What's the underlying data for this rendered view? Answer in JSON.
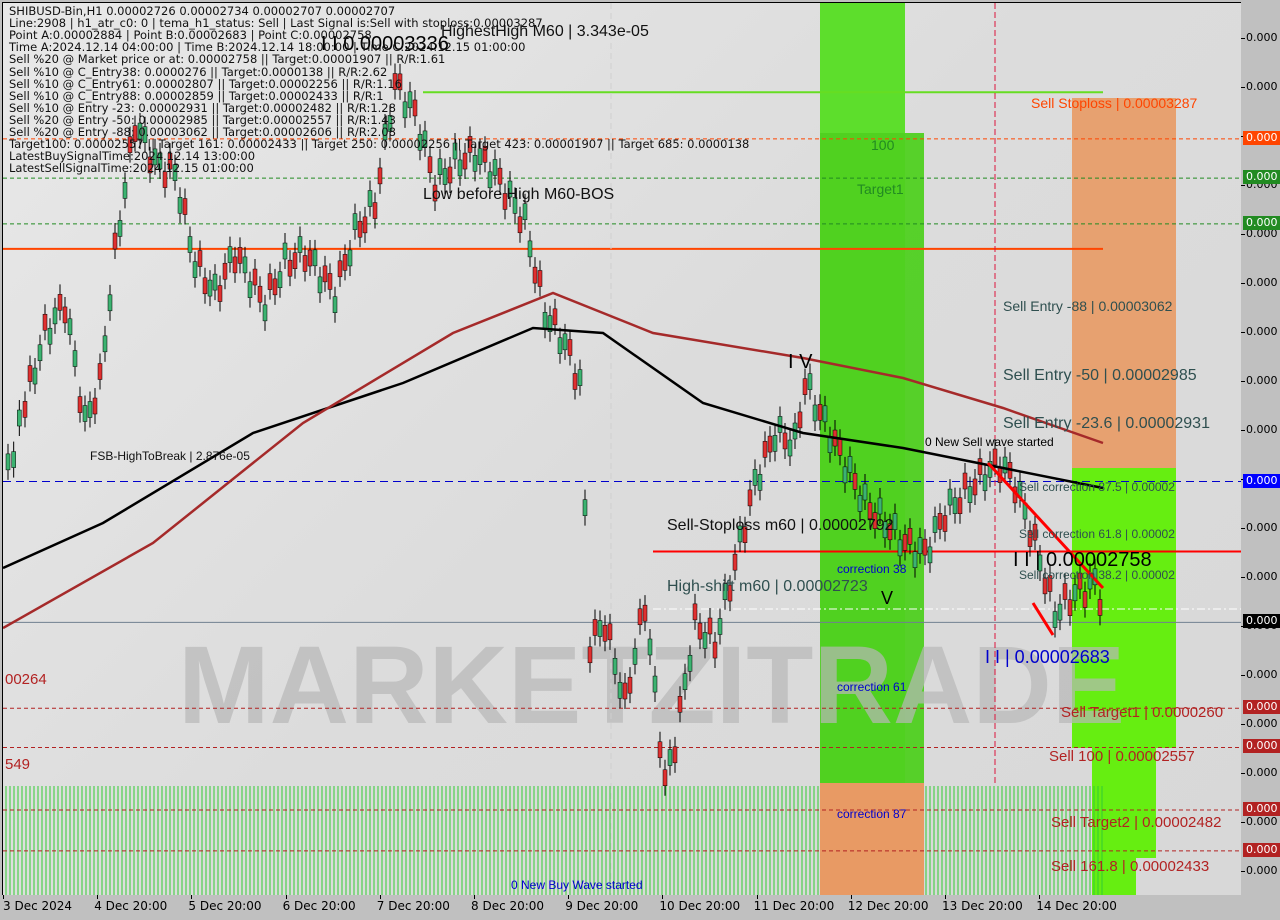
{
  "chart_data": {
    "type": "candlestick",
    "symbol": "SHIBUSD-Bin",
    "timeframe": "H1",
    "ohlc_header": {
      "open": "0.00002726",
      "high": "0.00002734",
      "low": "0.00002707",
      "close": "0.00002707"
    },
    "info_lines": [
      "SHIBUSD-Bin,H1  0.00002726 0.00002734 0.00002707 0.00002707",
      "Line:2908 | h1_atr_c0: 0 | tema_h1_status: Sell | Last Signal is:Sell with stoploss:0.00003287",
      "Point A:0.00002884 | Point B:0.00002683 | Point C:0.00002758",
      "Time A:2024.12.14 04:00:00 | Time B:2024.12.14 18:00:00 | Time C:2024.12.15 01:00:00",
      "Sell %20 @ Market price or at: 0.00002758 || Target:0.00001907 || R/R:1.61",
      "Sell %10 @ C_Entry38: 0.0000276 || Target:0.0000138 || R/R:2.62",
      "Sell %10 @ C_Entry61: 0.00002807 || Target:0.00002256 || R/R:1.16",
      "Sell %10 @ C_Entry88: 0.00002859 || Target:0.00002433 || R/R:1",
      "Sell %10 @ Entry -23: 0.00002931 || Target:0.00002482 || R/R:1.28",
      "Sell %20 @ Entry -50: 0.00002985 || Target:0.00002557 || R/R:1.43",
      "Sell %20 @ Entry -88: 0.00003062 || Target:0.00002606 || R/R:2.08",
      "Target100: 0.00002557 || Target 161: 0.00002433 || Target 250: 0.00002256 || Target 423: 0.00001907 || Target 685: 0.0000138",
      "LatestBuySignalTime:2024.12.14 13:00:00",
      "LatestSellSignalTime:2024.12.15 01:00:00"
    ],
    "x_tick_labels": [
      "3 Dec 2024",
      "4 Dec 20:00",
      "5 Dec 20:00",
      "6 Dec 20:00",
      "7 Dec 20:00",
      "8 Dec 20:00",
      "9 Dec 20:00",
      "10 Dec 20:00",
      "11 Dec 20:00",
      "12 Dec 20:00",
      "13 Dec 20:00",
      "14 Dec 20:00"
    ],
    "y_tick_label_text": "0.000",
    "y_range": [
      2.38e-05,
      3.45e-05
    ],
    "price_levels": [
      {
        "name": "HighestHigh M60",
        "text": "HighestHigh   M60 | 3.343e-05",
        "value": 3.343e-05,
        "color": "#66dd22",
        "style": "solid"
      },
      {
        "name": "Sell Stoploss",
        "text": "Sell Stoploss | 0.00003287",
        "value": 3.287e-05,
        "color": "#ff4500",
        "style": "dashed"
      },
      {
        "name": "Level 100",
        "text": "100",
        "value": 3.24e-05,
        "color": "#228b22",
        "style": "dashed"
      },
      {
        "name": "Target1",
        "text": "Target1",
        "value": 3.185e-05,
        "color": "#228b22",
        "style": "dashed"
      },
      {
        "name": "Low before High M60-BOS",
        "text": "Low before High   M60-BOS",
        "value": 3.155e-05,
        "color": "#ff4500",
        "style": "solid"
      },
      {
        "name": "Sell Entry -88",
        "text": "Sell Entry -88 | 0.00003062",
        "value": 3.062e-05,
        "color": "#2f4f4f",
        "style": "none"
      },
      {
        "name": "Sell Entry -50",
        "text": "Sell Entry -50 | 0.00002985",
        "value": 2.985e-05,
        "color": "#2f4f4f",
        "style": "none"
      },
      {
        "name": "Sell Entry -23.6",
        "text": "Sell Entry -23.6 | 0.00002931",
        "value": 2.931e-05,
        "color": "#2f4f4f",
        "style": "none"
      },
      {
        "name": "FSB-HighToBreak",
        "text": "FSB-HighToBreak | 2.876e-05",
        "value": 2.876e-05,
        "color": "#0000cd",
        "style": "dashed"
      },
      {
        "name": "Sell correction 87.5",
        "text": "Sell correction 87.5 | 0.00002",
        "value": 2.855e-05,
        "color": "#2f4f4f",
        "style": "none"
      },
      {
        "name": "Sell-Stoploss m60",
        "text": "Sell-Stoploss m60 | 0.00002792",
        "value": 2.792e-05,
        "color": "#ff0000",
        "style": "solid"
      },
      {
        "name": "Sell correction 61.8",
        "text": "Sell correction 61.8 | 0.00002",
        "value": 2.8e-05,
        "color": "#2f4f4f",
        "style": "none"
      },
      {
        "name": "Point C",
        "text": "I I | 0.00002758",
        "value": 2.758e-05,
        "color": "#000000",
        "style": "none"
      },
      {
        "name": "Sell correction 38.2",
        "text": "Sell correction 38.2 | 0.00002",
        "value": 2.745e-05,
        "color": "#2f4f4f",
        "style": "none"
      },
      {
        "name": "High-shift m60",
        "text": "High-shift m60 | 0.00002723",
        "value": 2.723e-05,
        "color": "#2f4f4f",
        "style": "dash-dot"
      },
      {
        "name": "Current price",
        "text": "",
        "value": 2.707e-05,
        "color": "#708090",
        "style": "solid"
      },
      {
        "name": "Point B",
        "text": "I I | 0.00002683",
        "value": 2.683e-05,
        "color": "#0000cd",
        "style": "none"
      },
      {
        "name": "Sell Target1",
        "text": "Sell Target1 | 0.0000260",
        "value": 2.604e-05,
        "color": "#b22222",
        "style": "dashed"
      },
      {
        "name": "Sell 100",
        "text": "Sell 100 | 0.00002557",
        "value": 2.557e-05,
        "color": "#b22222",
        "style": "dashed"
      },
      {
        "name": "Sell Target2",
        "text": "Sell Target2 | 0.00002482",
        "value": 2.482e-05,
        "color": "#b22222",
        "style": "dashed"
      },
      {
        "name": "Sell 161.8",
        "text": "Sell 161.8 | 0.00002433",
        "value": 2.433e-05,
        "color": "#b22222",
        "style": "dashed"
      }
    ],
    "annotations": [
      {
        "text": "I I 0.00003336",
        "color": "#000000"
      },
      {
        "text": "I V",
        "color": "#000000"
      },
      {
        "text": "V",
        "color": "#000000"
      },
      {
        "text": "0 New Sell wave started",
        "color": "#000000"
      },
      {
        "text": "0 New Buy Wave started",
        "color": "#0000cd"
      },
      {
        "text": "correction 38",
        "color": "#0000cd"
      },
      {
        "text": "correction 61",
        "color": "#0000cd"
      },
      {
        "text": "correction 87",
        "color": "#0000cd"
      },
      {
        "text": "00264",
        "color": "#b22222"
      },
      {
        "text": "549",
        "color": "#b22222"
      }
    ],
    "right_axis_badges": [
      {
        "value": 3.287e-05,
        "color": "#ff4500"
      },
      {
        "value": 3.24e-05,
        "color": "#228b22"
      },
      {
        "value": 3.185e-05,
        "color": "#228b22"
      },
      {
        "value": 2.876e-05,
        "color": "#0000ff"
      },
      {
        "value": 2.707e-05,
        "color": "#000000"
      },
      {
        "value": 2.604e-05,
        "color": "#b22222"
      },
      {
        "value": 2.557e-05,
        "color": "#b22222"
      },
      {
        "value": 2.482e-05,
        "color": "#b22222"
      },
      {
        "value": 2.433e-05,
        "color": "#b22222"
      }
    ],
    "moving_averages": [
      {
        "name": "MA fast",
        "color": "#000000"
      },
      {
        "name": "MA slow",
        "color": "#a52a2a"
      }
    ],
    "zones": [
      {
        "name": "buy-zone-1",
        "color": "#55dd22"
      },
      {
        "name": "sell-zone-stoploss",
        "color": "#f0945a"
      },
      {
        "name": "sell-zone-targets",
        "color": "#66ee11"
      }
    ],
    "watermark": "MARKETZITRADE"
  }
}
